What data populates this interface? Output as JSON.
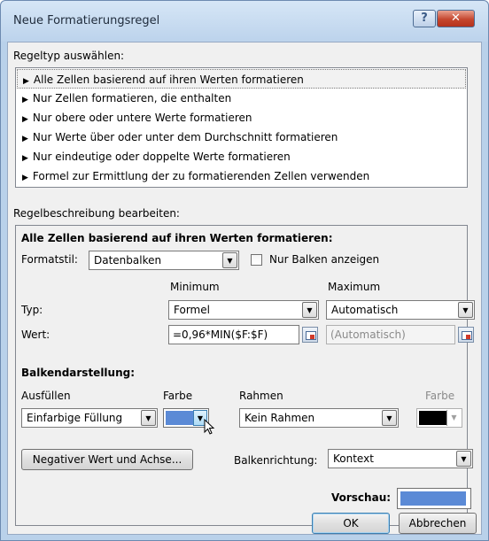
{
  "window": {
    "title": "Neue Formatierungsregel",
    "help_icon": "?",
    "close_icon": "✕"
  },
  "rule_type": {
    "label": "Regeltyp auswählen:",
    "items": [
      "Alle Zellen basierend auf ihren Werten formatieren",
      "Nur Zellen formatieren, die enthalten",
      "Nur obere oder untere Werte formatieren",
      "Nur Werte über oder unter dem Durchschnitt formatieren",
      "Nur eindeutige oder doppelte Werte formatieren",
      "Formel zur Ermittlung der zu formatierenden Zellen verwenden"
    ],
    "selected_index": 0,
    "arrow_icon": "▶"
  },
  "description": {
    "label": "Regelbeschreibung bearbeiten:",
    "heading": "Alle Zellen basierend auf ihren Werten formatieren:",
    "format_style_label": "Formatstil:",
    "format_style_value": "Datenbalken",
    "only_bar_label": "Nur Balken anzeigen",
    "only_bar_checked": false,
    "minimum_label": "Minimum",
    "maximum_label": "Maximum",
    "type_label": "Typ:",
    "type_min": "Formel",
    "type_max": "Automatisch",
    "value_label": "Wert:",
    "value_min": "=0,96*MIN($F:$F)",
    "value_max": "(Automatisch)"
  },
  "bar": {
    "heading": "Balkendarstellung:",
    "fill_label": "Ausfüllen",
    "fill_value": "Einfarbige Füllung",
    "color_label": "Farbe",
    "fill_color": "#5b8ad6",
    "border_label": "Rahmen",
    "border_value": "Kein Rahmen",
    "border_color_label": "Farbe",
    "border_color": "#000000",
    "negative_button": "Negativer Wert und Achse...",
    "direction_label": "Balkenrichtung:",
    "direction_value": "Kontext",
    "preview_label": "Vorschau:"
  },
  "footer": {
    "ok": "OK",
    "cancel": "Abbrechen"
  },
  "dropdown_icon": "▼"
}
